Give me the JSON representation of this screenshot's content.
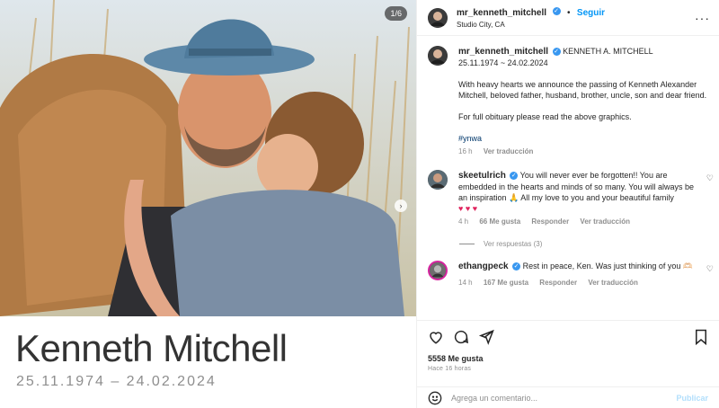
{
  "media": {
    "counter": "1/6",
    "caption_name": "Kenneth Mitchell",
    "caption_dates": "25.11.1974 – 24.02.2024"
  },
  "header": {
    "username": "mr_kenneth_mitchell",
    "follow_label": "Seguir",
    "location": "Studio City, CA",
    "more_icon": "more-horizontal-icon"
  },
  "post": {
    "username": "mr_kenneth_mitchell",
    "full_name": "KENNETH A. MITCHELL",
    "dates": "25.11.1974 ~ 24.02.2024",
    "paragraph1": "With heavy hearts we announce the passing of Kenneth Alexander Mitchell, beloved father, husband, brother, uncle, son and dear friend.",
    "paragraph2": "For full obituary please read the above graphics.",
    "hashtag": "#ynwa",
    "time": "16 h",
    "translate": "Ver traducción"
  },
  "comments": [
    {
      "username": "skeetulrich",
      "text": "You will never ever be forgotten!! You are embedded in the hearts and minds of so many. You will always be an inspiration 🙏 All my love to you and your beautiful family",
      "hearts": "♥ ♥ ♥",
      "time": "4 h",
      "likes": "66 Me gusta",
      "reply": "Responder",
      "translate": "Ver traducción",
      "view_replies": "Ver respuestas (3)"
    },
    {
      "username": "ethangpeck",
      "text": "Rest in peace, Ken. Was just thinking of you 🫶🏻",
      "time": "14 h",
      "likes": "167 Me gusta",
      "reply": "Responder",
      "translate": "Ver traducción"
    }
  ],
  "actions": {
    "likes": "5558 Me gusta",
    "ago": "Hace 16 horas"
  },
  "add_comment": {
    "placeholder": "Agrega un comentario...",
    "publish": "Publicar"
  },
  "colors": {
    "accent": "#0095f6",
    "verified": "#3897f0",
    "muted": "#8e8e8e"
  }
}
